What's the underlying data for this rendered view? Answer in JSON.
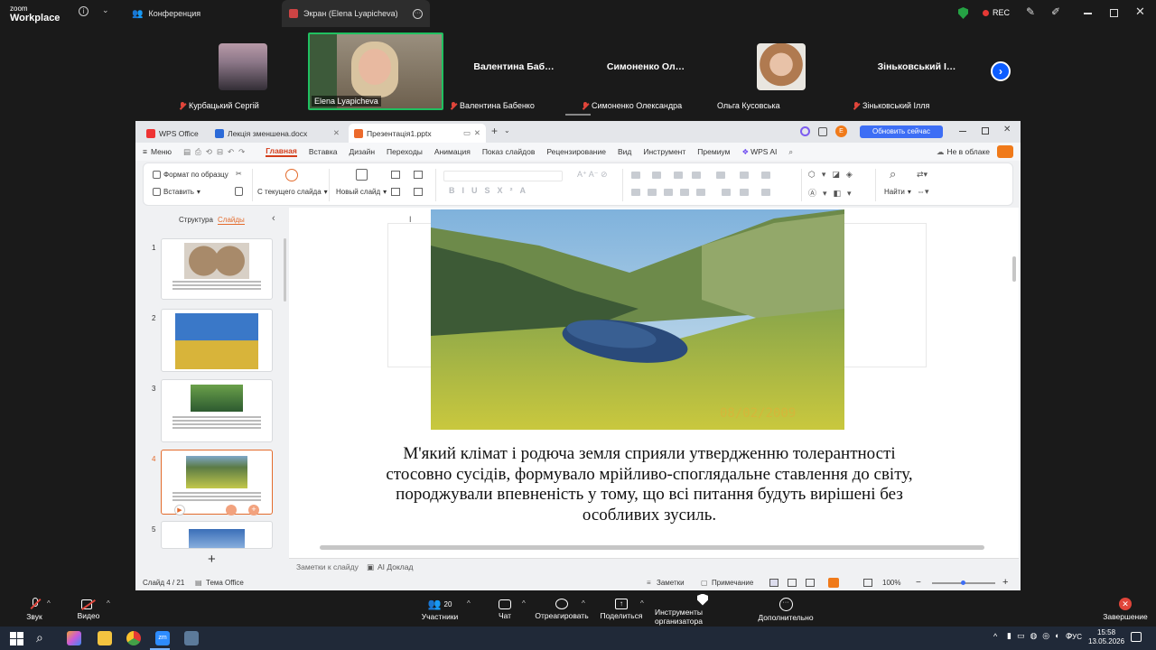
{
  "zoom_top": {
    "logo_line1": "zoom",
    "logo_line2": "Workplace",
    "tab_conference": "Конференция",
    "tab_screen": "Экран (Elena Lyapicheva)",
    "rec": "REC"
  },
  "participants": [
    {
      "name": "Курбацький Сергій",
      "muted": true,
      "has_video": false
    },
    {
      "name": "Elena Lyapicheva",
      "muted": false,
      "has_video": true,
      "active": true
    },
    {
      "display": "Валентина  Баб…",
      "name": "Валентина Бабенко",
      "muted": true
    },
    {
      "display": "Симоненко  Ол…",
      "name": "Симоненко Олександра",
      "muted": true
    },
    {
      "name": "Ольга Кусовська",
      "muted": false
    },
    {
      "display": "Зіньковський І…",
      "name": "Зіньковський Ілля",
      "muted": true
    }
  ],
  "wps": {
    "tabs": [
      "WPS Office",
      "Лекція  зменшена.docx",
      "Презентація1.pptx"
    ],
    "update_button": "Обновить сейчас",
    "user_initial": "E",
    "menu_label": "Меню",
    "menu_items": [
      "Главная",
      "Вставка",
      "Дизайн",
      "Переходы",
      "Анимация",
      "Показ слайдов",
      "Рецензирование",
      "Вид",
      "Инструмент",
      "Премиум"
    ],
    "wps_ai": "WPS AI",
    "cloud": "Не в облаке",
    "ribbon": {
      "format_painter": "Формат по образцу",
      "paste": "Вставить",
      "from_current": "С текущего слайда",
      "new_slide": "Новый слайд",
      "find": "Найти"
    },
    "panel_tabs": [
      "Структура",
      "Слайды"
    ],
    "slide_numbers": [
      "1",
      "2",
      "3",
      "4",
      "5"
    ],
    "slide_text": "М'який клімат і родюча земля сприяли утвердженню толерантності стосовно сусідів, формувало мрійливо-споглядальне ставлення до світу, породжували впевненість у тому, що всі питання будуть вирішені без особливих зусиль.",
    "photo_date": "08/02/2009",
    "notes_placeholder": "Заметки к слайду",
    "ai_report": "AI Доклад",
    "status_slide": "Слайд 4 / 21",
    "status_theme": "Тема Office",
    "status_notes": "Заметки",
    "status_comment": "Примечание",
    "zoom_level": "100%"
  },
  "zoom_bottom": {
    "sound": "Звук",
    "video": "Видео",
    "participants": "Участники",
    "participants_count": "20",
    "chat": "Чат",
    "react": "Отреагировать",
    "share": "Поделиться",
    "host_tools": "Инструменты организатора",
    "more": "Дополнительно",
    "end": "Завершение"
  },
  "taskbar": {
    "lang": "РУС",
    "time": "15:58",
    "date": "13.05.2026"
  }
}
